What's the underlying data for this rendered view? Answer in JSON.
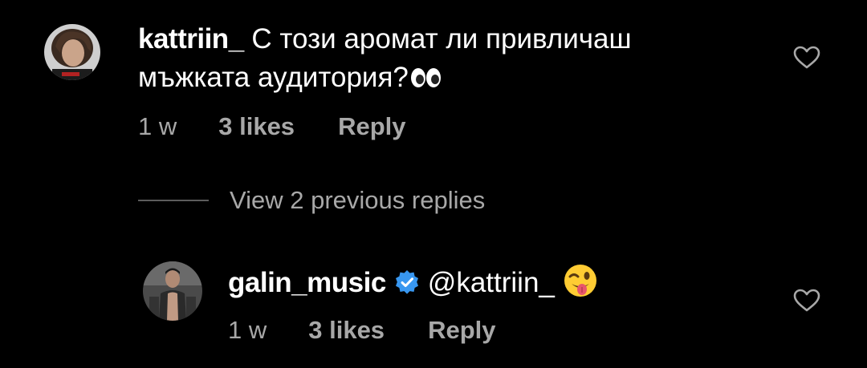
{
  "comments": [
    {
      "username": "kattriin_",
      "text_line1": "С този аромат ли привличаш",
      "text_line2": "мъжката аудитория?",
      "emoji": "eyes-emoji",
      "time": "1 w",
      "likes": "3 likes",
      "reply_label": "Reply",
      "liked": false
    },
    {
      "username": "galin_music",
      "verified": true,
      "mention": "@kattriin_",
      "emoji": "winking-face-with-tongue-emoji",
      "time": "1 w",
      "likes": "3 likes",
      "reply_label": "Reply",
      "liked": false
    }
  ],
  "view_replies_label": "View 2 previous replies",
  "colors": {
    "background": "#000000",
    "primary_text": "#ffffff",
    "secondary_text": "#a8a8a8",
    "verified_badge": "#3897f0"
  }
}
